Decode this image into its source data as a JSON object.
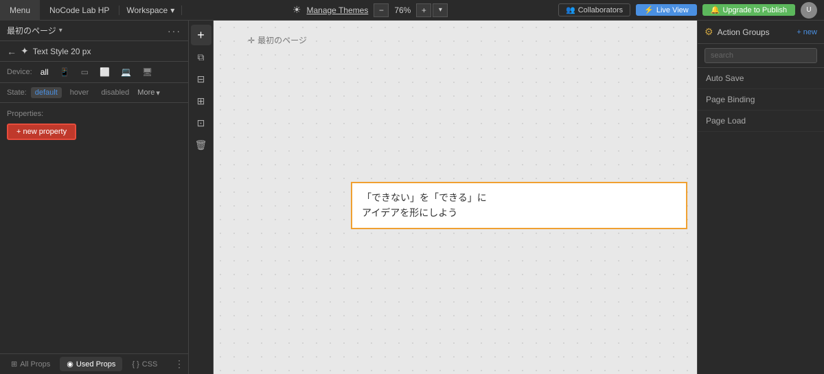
{
  "topNav": {
    "menu_label": "Menu",
    "brand_label": "NoCode Lab HP",
    "workspace_label": "Workspace",
    "manage_themes_label": "Manage Themes",
    "zoom_value": "76%",
    "zoom_minus": "−",
    "zoom_plus": "+",
    "collaborators_label": "Collaborators",
    "live_view_label": "Live View",
    "upgrade_label": "Upgrade to Publish"
  },
  "leftPanel": {
    "page_title": "最初のページ",
    "element_title": "Text Style 20 px",
    "device_label": "Device:",
    "device_all": "all",
    "state_label": "State:",
    "state_default": "default",
    "state_hover": "hover",
    "state_disabled": "disabled",
    "state_more": "More",
    "properties_label": "Properties:",
    "new_property_btn": "+ new property",
    "tab_all_props": "All Props",
    "tab_used_props": "Used Props",
    "tab_css": "CSS"
  },
  "toolbar": {
    "add_icon": "+",
    "copy_icon": "⧉",
    "layers_icon": "⊟",
    "add_section_icon": "⊞",
    "component_icon": "⊡",
    "delete_icon": "🗑"
  },
  "canvas": {
    "page_label": "最初のページ",
    "text_line1": "「できない」を「できる」に",
    "text_line2": "アイデアを形にしよう"
  },
  "rightPanel": {
    "title": "Action Groups",
    "new_label": "+ new",
    "search_placeholder": "search",
    "items": [
      {
        "label": "Auto Save"
      },
      {
        "label": "Page Binding"
      },
      {
        "label": "Page Load"
      }
    ]
  }
}
